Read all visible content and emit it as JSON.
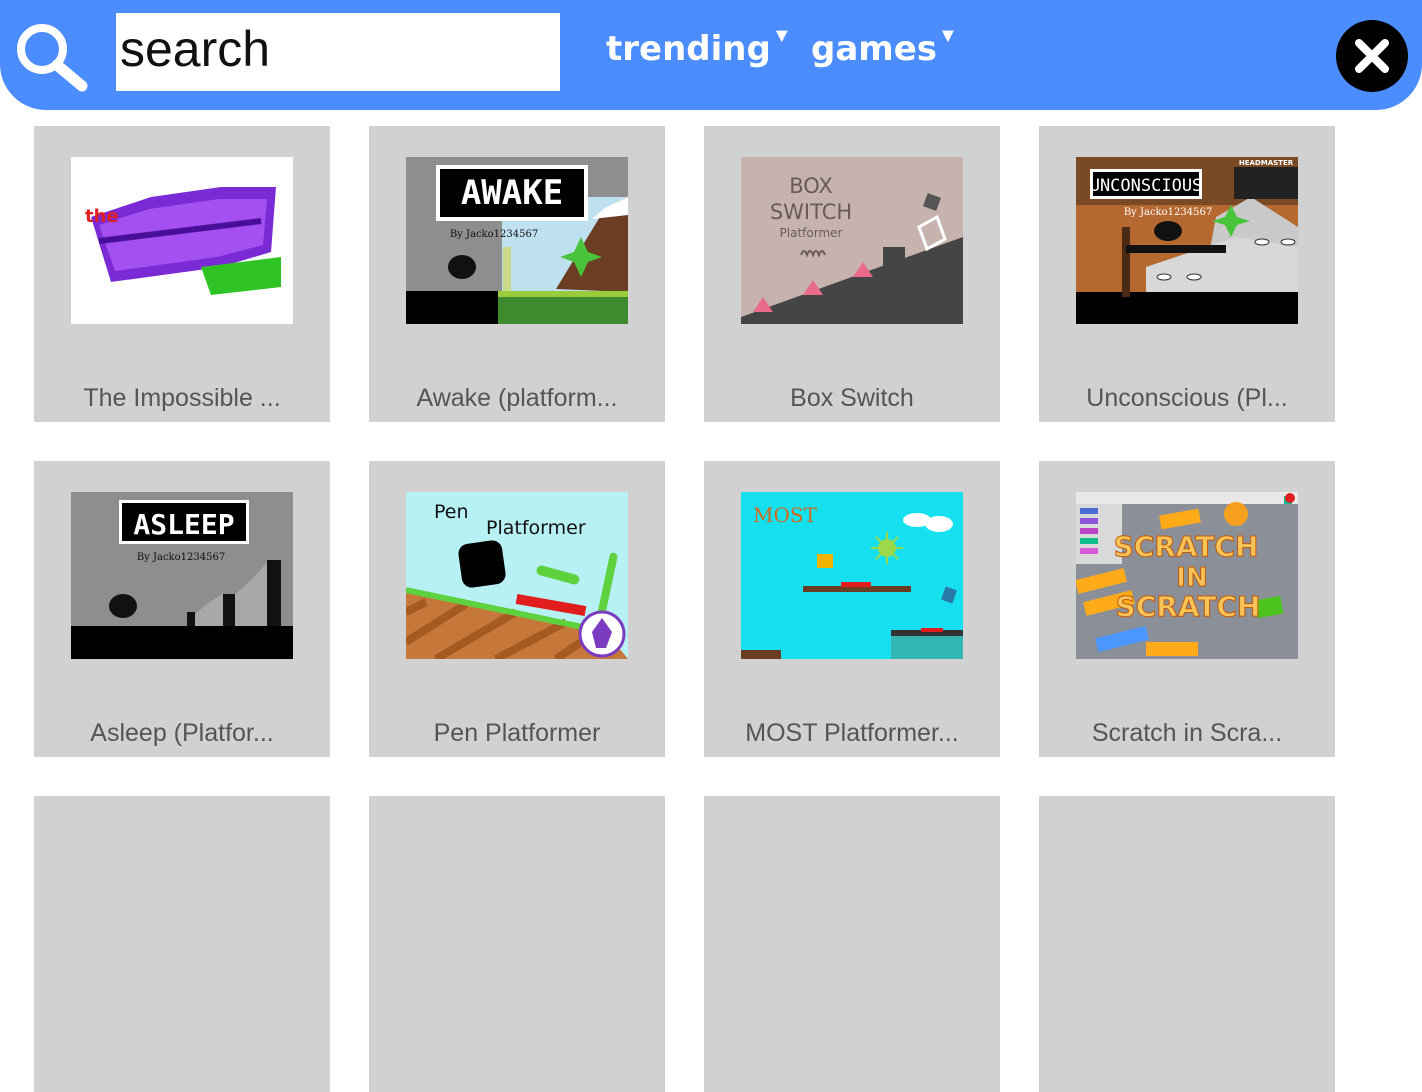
{
  "header": {
    "search": {
      "placeholder": "search"
    },
    "filters": [
      {
        "label": "trending"
      },
      {
        "label": "games"
      }
    ]
  },
  "thumb_text": {
    "awake": "AWAKE",
    "awake_by": "By Jacko1234567",
    "box_line1": "BOX",
    "box_line2": "SWITCH",
    "box_line3": "Platformer",
    "unconscious": "UNCONSCIOUS",
    "unconscious_by": "By Jacko1234567",
    "headmaster": "HEADMASTER",
    "asleep": "ASLEEP",
    "asleep_by": "By Jacko1234567",
    "pen_line1": "Pen",
    "pen_line2": "Platformer",
    "most": "MOST",
    "scratch_line1": "SCRATCH",
    "scratch_line2": "IN",
    "scratch_line3": "SCRATCH"
  },
  "projects": [
    {
      "title": "The Impossible ..."
    },
    {
      "title": "Awake (platform..."
    },
    {
      "title": "Box Switch"
    },
    {
      "title": "Unconscious (Pl..."
    },
    {
      "title": "Asleep (Platfor..."
    },
    {
      "title": "Pen Platformer"
    },
    {
      "title": "MOST Platformer..."
    },
    {
      "title": "Scratch in Scra..."
    }
  ],
  "colors": {
    "header_bg": "#4c8dfd",
    "card_bg": "#d1d1d1",
    "card_text": "#555555"
  }
}
